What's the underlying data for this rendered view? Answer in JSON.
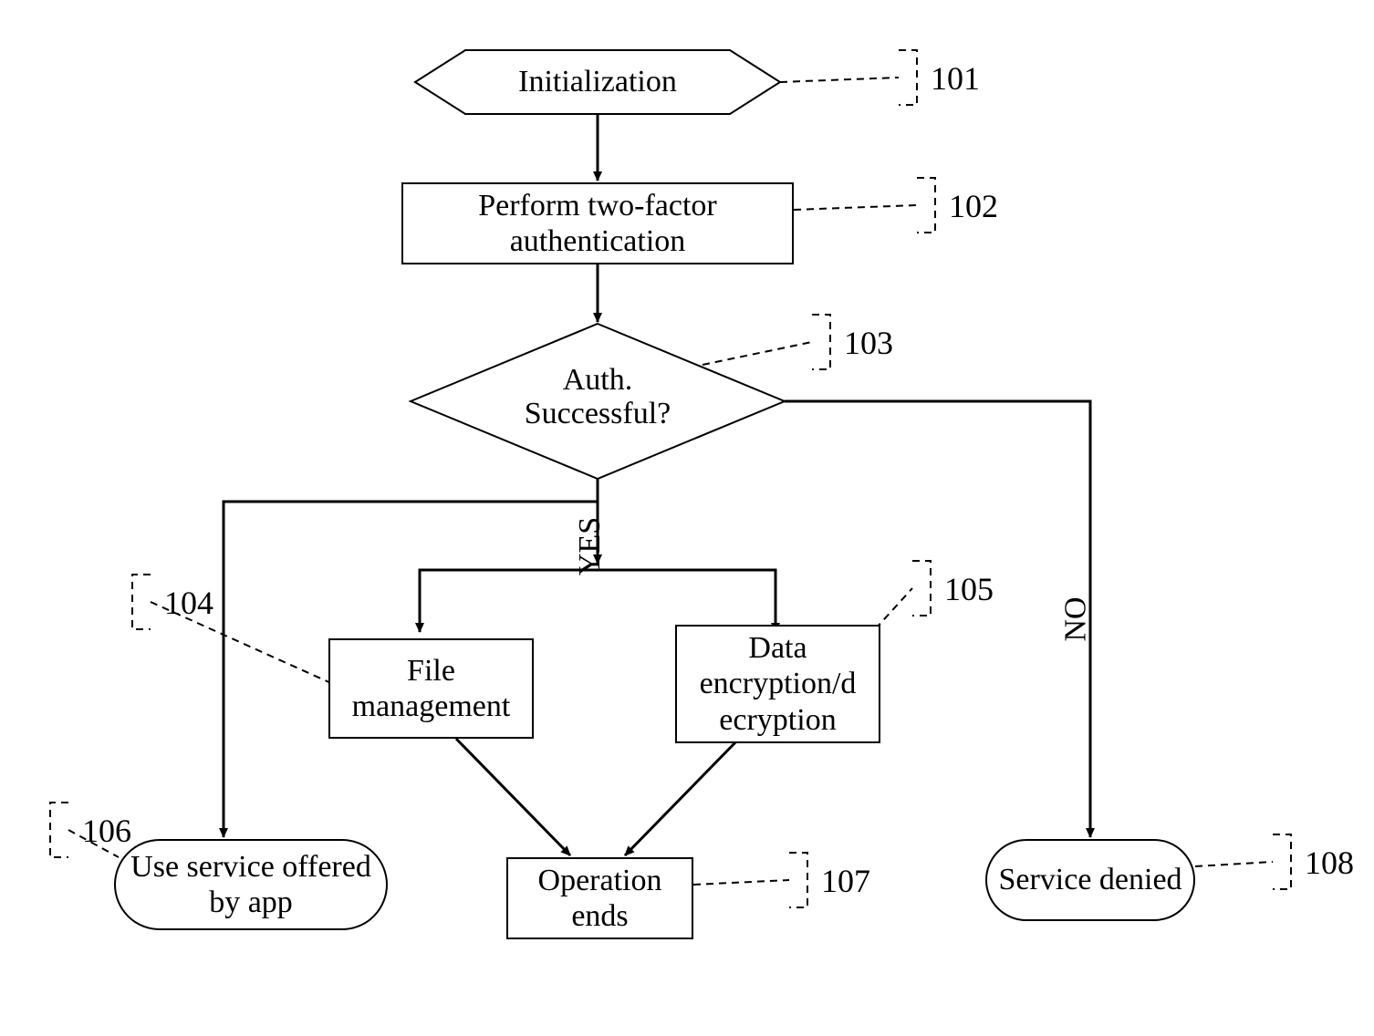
{
  "nodes": {
    "init": "Initialization",
    "auth": "Perform two-factor authentication",
    "decision": "Auth. Successful?",
    "file": "File management",
    "data": "Data encryption/d ecryption",
    "useService": "Use service offered by app",
    "opEnds": "Operation ends",
    "denied": "Service denied"
  },
  "refs": {
    "r101": "101",
    "r102": "102",
    "r103": "103",
    "r104": "104",
    "r105": "105",
    "r106": "106",
    "r107": "107",
    "r108": "108"
  },
  "edges": {
    "yes": "YES",
    "no": "NO"
  }
}
